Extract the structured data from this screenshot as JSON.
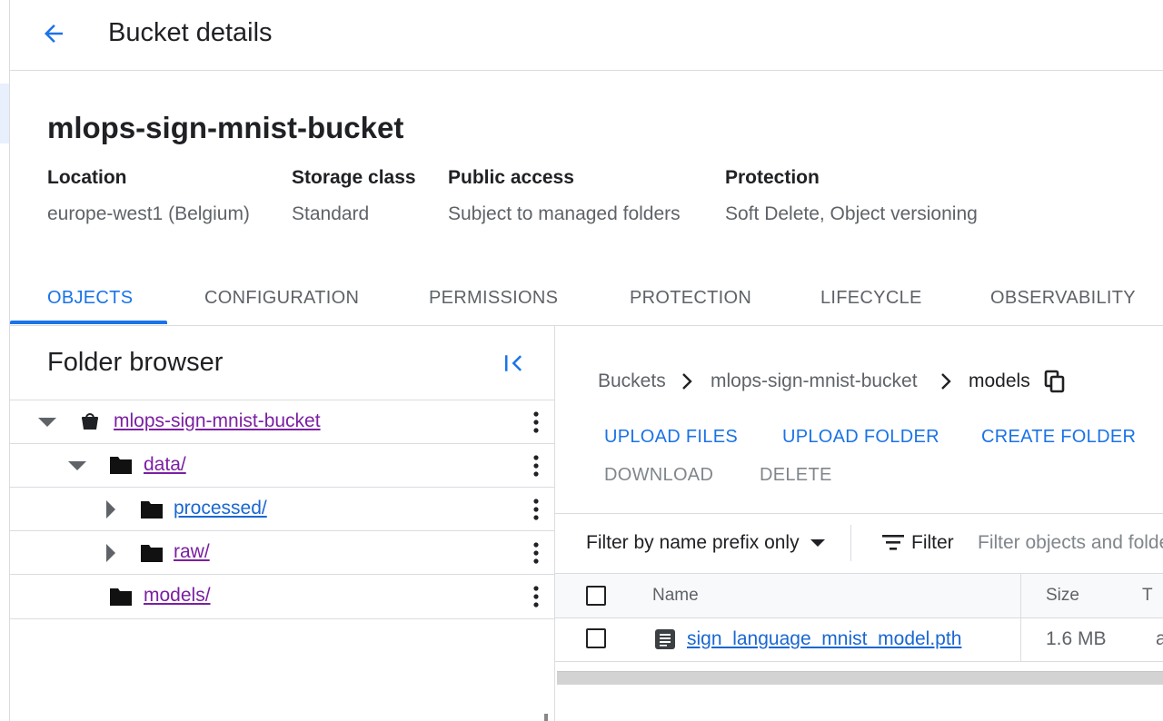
{
  "header": {
    "back_icon": "arrow-left-icon",
    "title": "Bucket details"
  },
  "bucket": {
    "name": "mlops-sign-mnist-bucket",
    "meta": [
      {
        "label": "Location",
        "value": "europe-west1 (Belgium)"
      },
      {
        "label": "Storage class",
        "value": "Standard"
      },
      {
        "label": "Public access",
        "value": "Subject to managed folders"
      },
      {
        "label": "Protection",
        "value": "Soft Delete, Object versioning"
      }
    ]
  },
  "tabs": [
    {
      "label": "OBJECTS",
      "active": true
    },
    {
      "label": "CONFIGURATION"
    },
    {
      "label": "PERMISSIONS"
    },
    {
      "label": "PROTECTION"
    },
    {
      "label": "LIFECYCLE"
    },
    {
      "label": "OBSERVABILITY"
    }
  ],
  "folder_browser": {
    "title": "Folder browser",
    "collapse_icon": "collapse-panel-icon",
    "tree": [
      {
        "label": "mlops-sign-mnist-bucket",
        "icon": "bucket-icon",
        "state": "expanded",
        "visited": true
      },
      {
        "label": "data/",
        "icon": "folder-icon",
        "state": "expanded",
        "visited": true
      },
      {
        "label": "processed/",
        "icon": "folder-icon",
        "state": "collapsed",
        "visited": false
      },
      {
        "label": "raw/",
        "icon": "folder-icon",
        "state": "collapsed",
        "visited": true
      },
      {
        "label": "models/",
        "icon": "folder-icon",
        "state": "leaf",
        "visited": true
      }
    ]
  },
  "breadcrumb": {
    "items": [
      "Buckets",
      "mlops-sign-mnist-bucket",
      "models"
    ],
    "separator_icon": "chevron-right-icon",
    "copy_icon": "copy-icon"
  },
  "actions": {
    "upload_files": "UPLOAD FILES",
    "upload_folder": "UPLOAD FOLDER",
    "create_folder": "CREATE FOLDER",
    "download": "DOWNLOAD",
    "delete": "DELETE"
  },
  "filter": {
    "type_label": "Filter by name prefix only",
    "button_label": "Filter",
    "placeholder": "Filter objects and folders",
    "filter_icon": "filter-lines-icon"
  },
  "table": {
    "columns": [
      "Name",
      "Size",
      "T"
    ],
    "rows": [
      {
        "name": "sign_language_mnist_model.pth",
        "size": "1.6 MB",
        "type": "a",
        "icon": "file-icon"
      }
    ]
  },
  "colors": {
    "accent": "#1a73e8",
    "visited_link": "#7b1fa2",
    "text": "#202124",
    "muted": "#5f6368",
    "border": "#dadce0"
  }
}
